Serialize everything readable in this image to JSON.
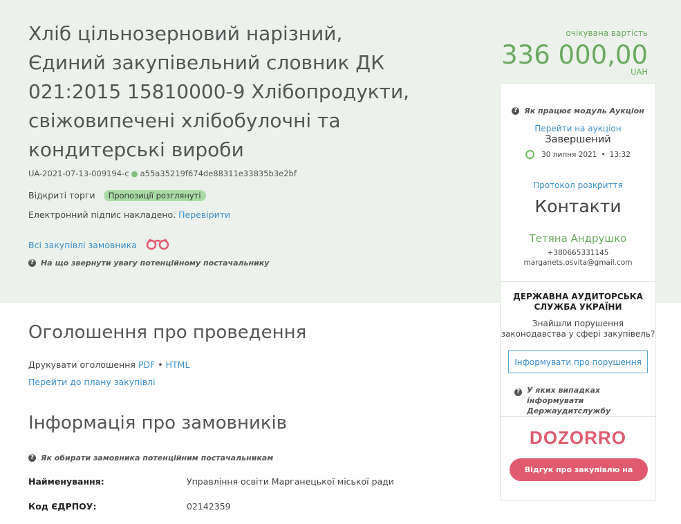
{
  "tender": {
    "title": "Хліб цільнозерновий нарізний, Єдиний закупівельний словник ДК 021:2015 15810000-9 Хлібопродукти, свіжовипечені хлібобулочні та кондитерські вироби",
    "id": "UA-2021-07-13-009194-c",
    "hash": "a55a35219f674de88311e33835b3e2bf",
    "procedure": "Відкриті торги",
    "status_badge": "Пропозиції розглянуті",
    "signature_text": "Електронний підпис накладено.",
    "signature_link": "Перевірити",
    "all_purchases_link": "Всі закупівлі замовника",
    "attention_hint": "На що звернути увагу потенційному постачальнику"
  },
  "price": {
    "label": "очікувана вартість",
    "amount": "336 000,00",
    "currency": "UAH"
  },
  "announcement": {
    "heading": "Оголошення про проведення",
    "print_label": "Друкувати оголошення",
    "pdf": "PDF",
    "sep": "•",
    "html": "HTML",
    "plan_link": "Перейти до плану закупівлі"
  },
  "customers": {
    "heading": "Інформація про замовників",
    "hint": "Як обирати замовника потенційним постачальникам",
    "fields": [
      {
        "label": "Найменування:",
        "value": "Управління освіти Марганецької міської ради"
      },
      {
        "label": "Код ЄДРПОУ:",
        "value": "02142359"
      }
    ]
  },
  "sidebar": {
    "auction_hint": "Як працює модуль Аукціон",
    "goto_auction": "Перейти на аукціон",
    "auction_status": "Завершений",
    "auction_date": "30 липня 2021",
    "auction_time": "13:32",
    "protocol_link": "Протокол розкриття",
    "contacts_heading": "Контакти",
    "contact_name": "Тетяна Андрушко",
    "contact_phone": "+380665331145",
    "contact_email": "marganets.osvita@gmail.com",
    "dasu_title": "ДЕРЖАВНА АУДИТОРСЬКА СЛУЖБА УКРАЇНИ",
    "dasu_text": "Знайшли порушення законодавства у сфері закупівель?",
    "dasu_button": "Інформувати про порушення",
    "dasu_hint": "У яких випадках інформувати Держаудитслужбу",
    "dozorro_logo": "DOZORRO",
    "dozorro_button": "Відгук про закупівлю на Дозорро"
  },
  "colors": {
    "accent_green": "#6aaa5f",
    "link_blue": "#3a8fc9",
    "dozorro_red": "#e05b6f",
    "hero_bg": "#ecf1ec"
  }
}
